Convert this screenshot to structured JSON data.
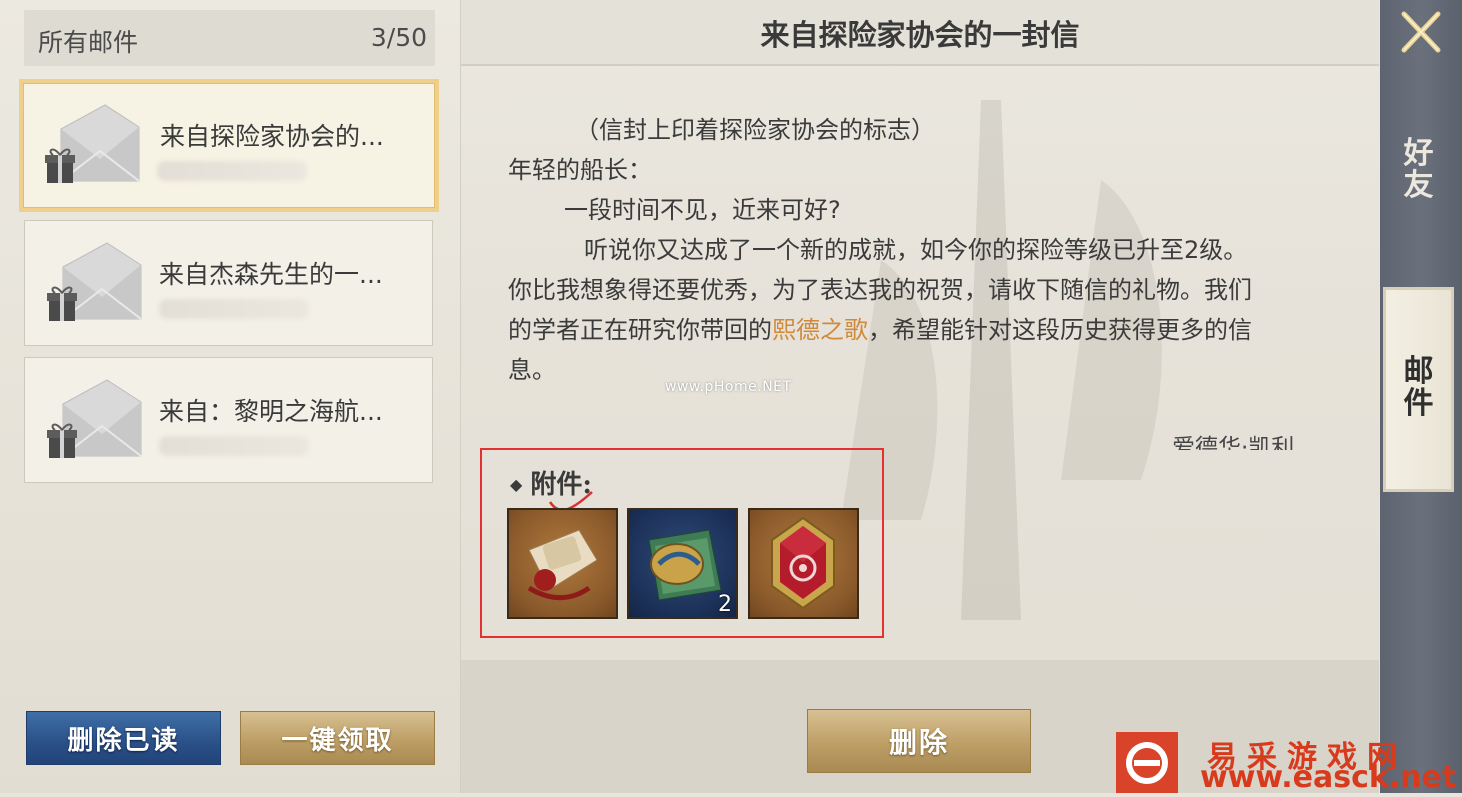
{
  "mail_list": {
    "header_title": "所有邮件",
    "count": "3/50",
    "items": [
      {
        "subject": "来自探险家协会的...",
        "selected": true
      },
      {
        "subject": "来自杰森先生的一...",
        "selected": false
      },
      {
        "subject": "来自：黎明之海航...",
        "selected": false
      }
    ],
    "delete_read_label": "删除已读",
    "claim_all_label": "一键领取"
  },
  "letter": {
    "title": "来自探险家协会的一封信",
    "line1": "（信封上印着探险家协会的标志）",
    "line2": "年轻的船长：",
    "line3": "一段时间不见，近来可好?",
    "line4": "听说你又达成了一个新的成就，如今你的探险等级已升至2级。",
    "line5": "你比我想象得还要优秀，为了表达我的祝贺，请收下随信的礼物。我们",
    "line6_pre": "的学者正在研究你带回的",
    "line6_highlight": "熙德之歌",
    "line6_post": "，希望能针对这段历史获得更多的信",
    "line7": "息。",
    "signature": "爱德华·凯利",
    "attachments_label": "附件:",
    "attachments": [
      {
        "name": "scroll-letter-icon",
        "qty": ""
      },
      {
        "name": "map-book-icon",
        "qty": "2"
      },
      {
        "name": "red-gem-icon",
        "qty": ""
      }
    ],
    "delete_label": "删除",
    "highlight_color": "#d08a3c"
  },
  "side_tabs": {
    "friends": "好友",
    "mail": "邮件"
  },
  "watermarks": {
    "mid": "www.pHome.NET",
    "site_name": "易采游戏网",
    "site_url": "www.easck.net"
  }
}
